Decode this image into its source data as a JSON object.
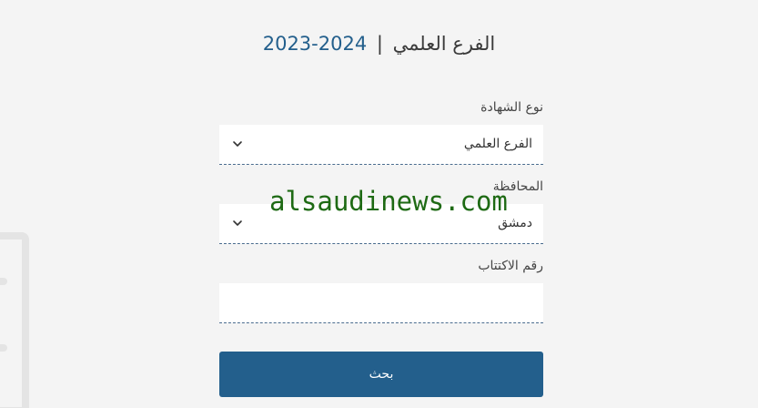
{
  "header": {
    "title_text": "الفرع العلمي",
    "separator": "|",
    "year": "2024-2023"
  },
  "form": {
    "certificate_type": {
      "label": "نوع الشهادة",
      "value": "الفرع العلمي"
    },
    "governorate": {
      "label": "المحافظة",
      "value": "دمشق"
    },
    "subscription_number": {
      "label": "رقم الاكتتاب",
      "value": ""
    },
    "search_label": "بحث"
  },
  "watermark": {
    "text": "alsaudinews.com"
  },
  "colors": {
    "accent": "#235f8c",
    "watermark": "#1e6a14",
    "background": "#f4f4f4"
  },
  "icons": {
    "dropdown": "chevron-down-icon"
  }
}
